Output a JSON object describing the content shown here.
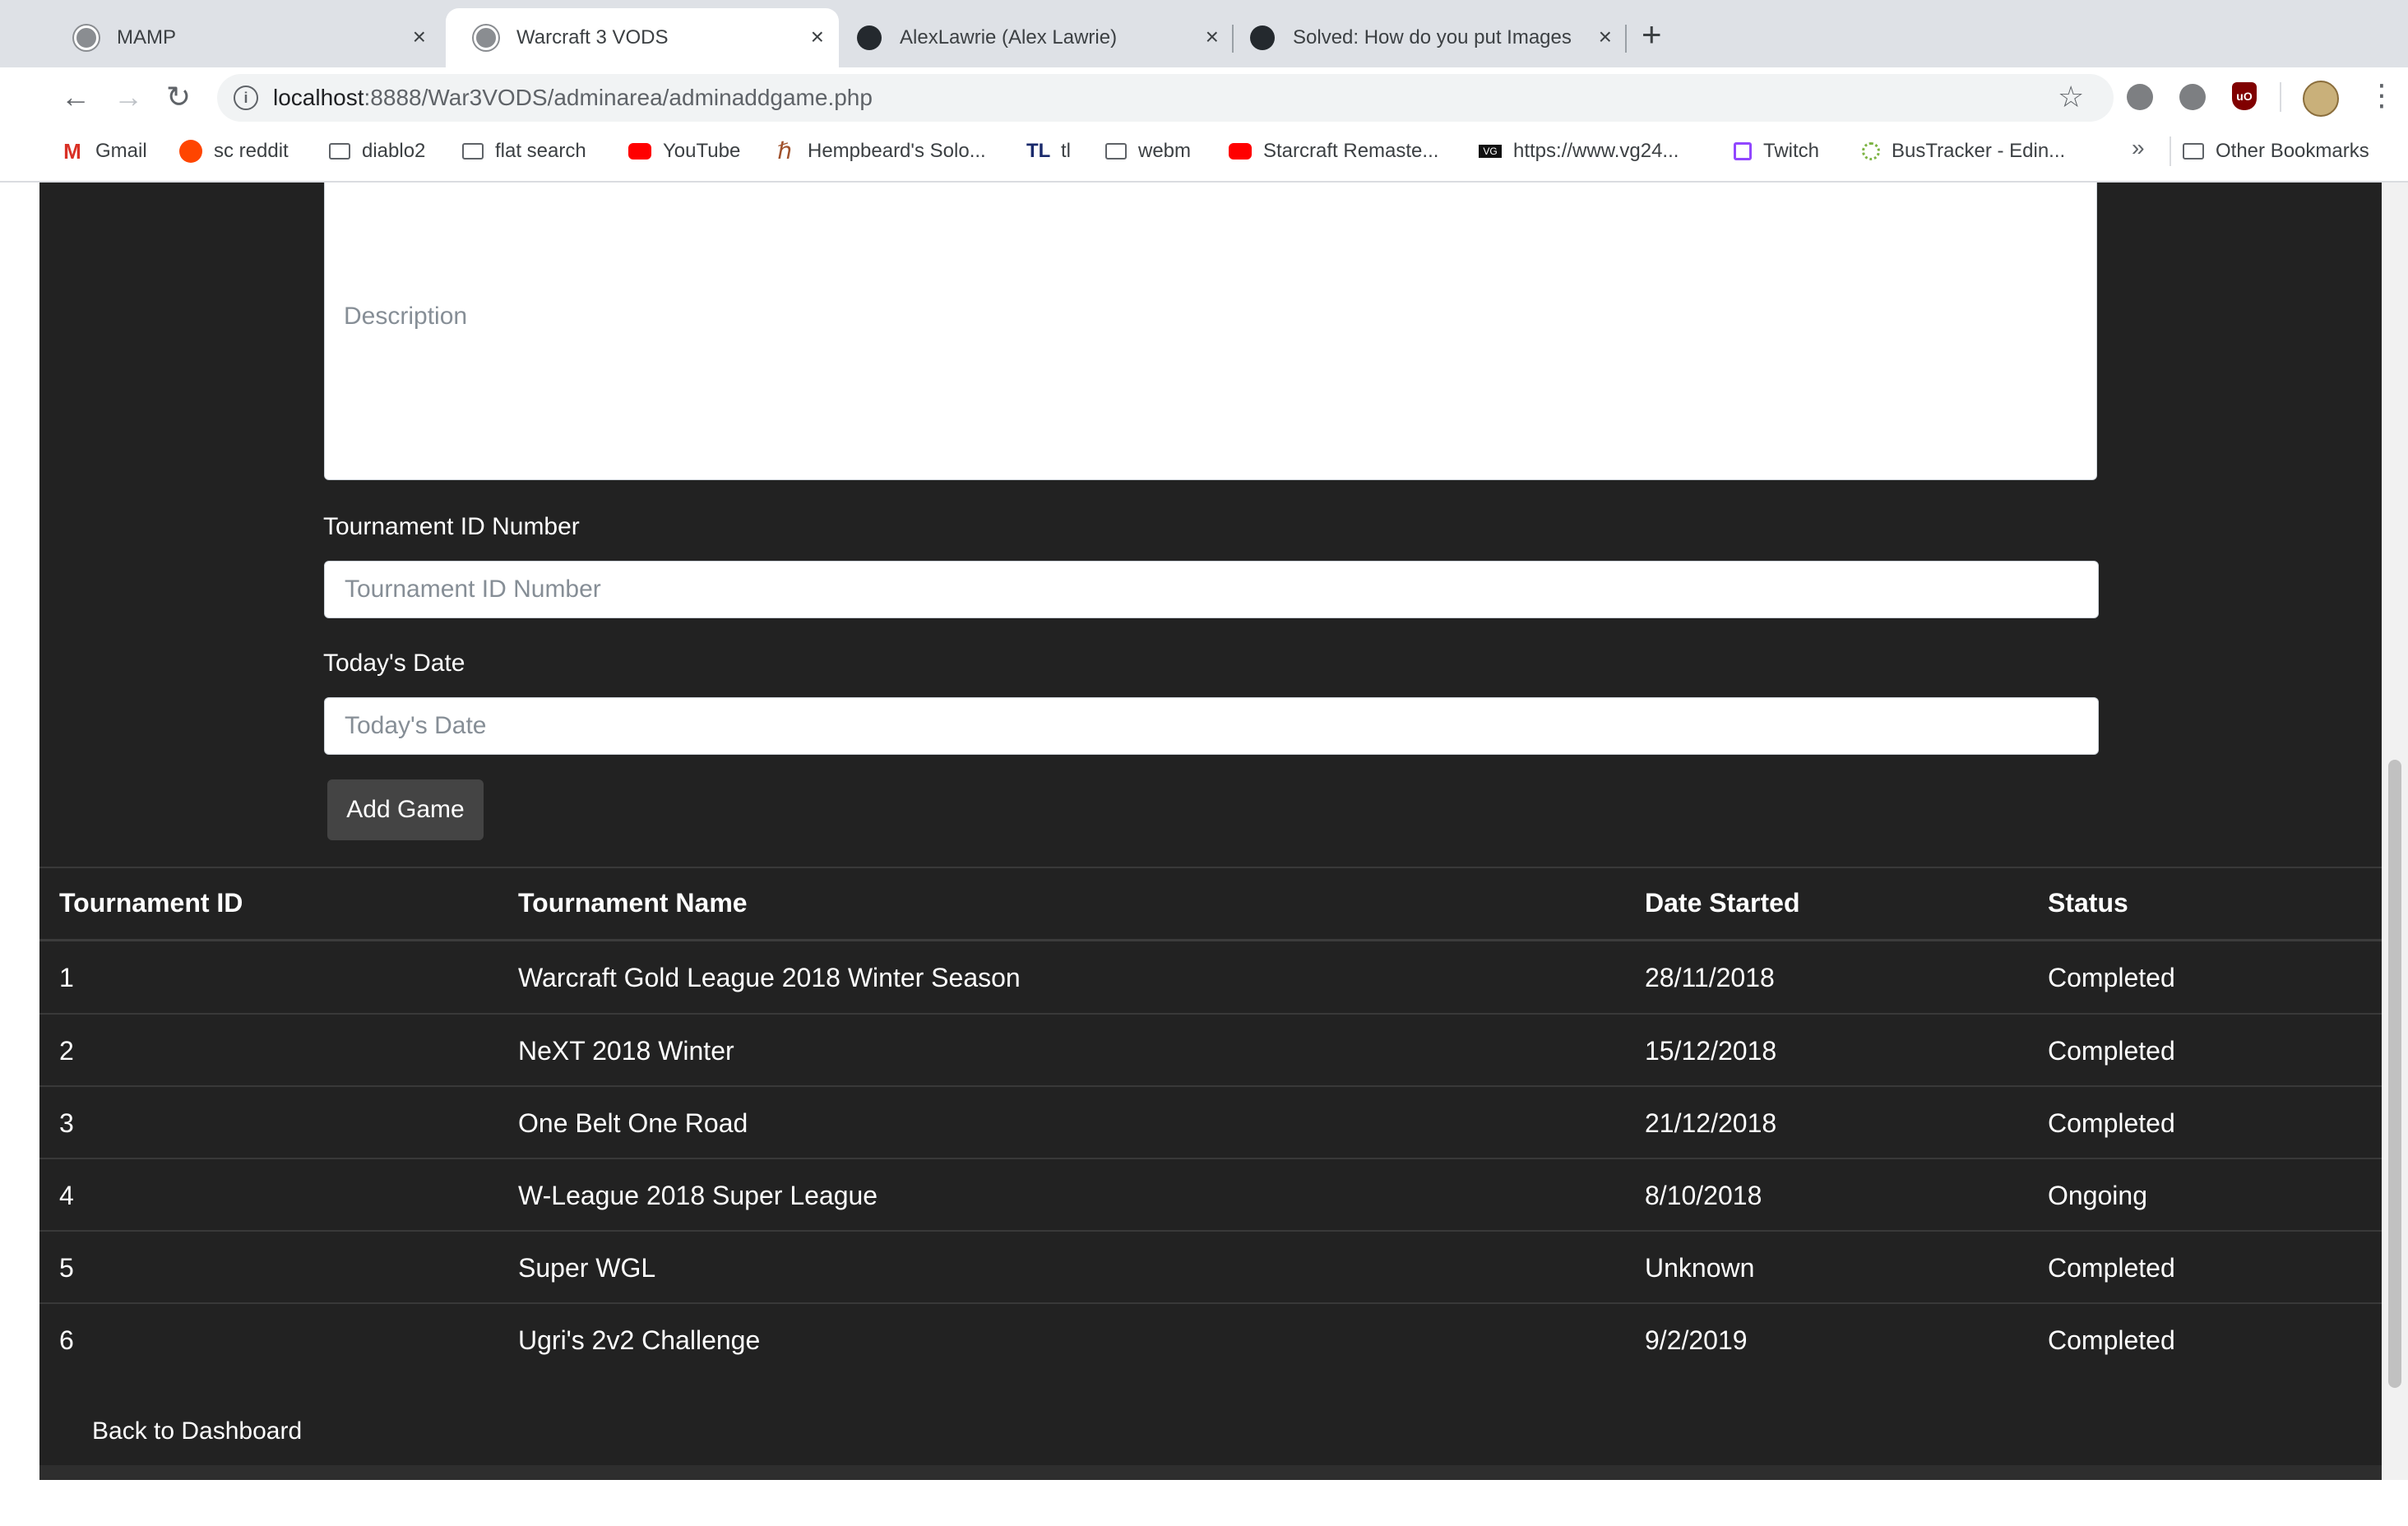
{
  "browser": {
    "tabs": [
      {
        "title": "MAMP",
        "close": "×"
      },
      {
        "title": "Warcraft 3 VODS",
        "close": "×"
      },
      {
        "title": "AlexLawrie (Alex Lawrie)",
        "close": "×"
      },
      {
        "title": "Solved: How do you put Images",
        "close": "×"
      }
    ],
    "new_tab": "+",
    "url_host": "localhost",
    "url_path": ":8888/War3VODS/adminarea/adminaddgame.php",
    "bookmarks": [
      {
        "label": "Gmail",
        "icon": "gmail-icon"
      },
      {
        "label": "sc reddit",
        "icon": "reddit-icon"
      },
      {
        "label": "diablo2",
        "icon": "folder-icon"
      },
      {
        "label": "flat search",
        "icon": "folder-icon"
      },
      {
        "label": "YouTube",
        "icon": "youtube-icon"
      },
      {
        "label": "Hempbeard's Solo...",
        "icon": "hempbeard-icon"
      },
      {
        "label": "tl",
        "icon": "teamliquid-icon"
      },
      {
        "label": "webm",
        "icon": "folder-icon"
      },
      {
        "label": "Starcraft Remaste...",
        "icon": "youtube-icon"
      },
      {
        "label": "https://www.vg24...",
        "icon": "vg247-icon"
      },
      {
        "label": "Twitch",
        "icon": "twitch-icon"
      },
      {
        "label": "BusTracker - Edin...",
        "icon": "bustracker-icon"
      }
    ],
    "more_bookmarks": "»",
    "other_bookmarks": "Other Bookmarks"
  },
  "form": {
    "description_placeholder": "Description",
    "tournament_id_label": "Tournament ID Number",
    "tournament_id_placeholder": "Tournament ID Number",
    "date_label": "Today's Date",
    "date_placeholder": "Today's Date",
    "submit_label": "Add Game"
  },
  "table": {
    "headers": [
      "Tournament ID",
      "Tournament Name",
      "Date Started",
      "Status"
    ],
    "rows": [
      {
        "id": "1",
        "name": "Warcraft Gold League 2018 Winter Season",
        "date": "28/11/2018",
        "status": "Completed"
      },
      {
        "id": "2",
        "name": "NeXT 2018 Winter",
        "date": "15/12/2018",
        "status": "Completed"
      },
      {
        "id": "3",
        "name": "One Belt One Road",
        "date": "21/12/2018",
        "status": "Completed"
      },
      {
        "id": "4",
        "name": "W-League 2018 Super League",
        "date": "8/10/2018",
        "status": "Ongoing"
      },
      {
        "id": "5",
        "name": "Super WGL",
        "date": "Unknown",
        "status": "Completed"
      },
      {
        "id": "6",
        "name": "Ugri's 2v2 Challenge",
        "date": "9/2/2019",
        "status": "Completed"
      }
    ]
  },
  "footer": {
    "back_label": "Back to Dashboard"
  },
  "colors": {
    "page_bg": "#222222",
    "button_bg": "#444444",
    "row_border": "#393939"
  }
}
